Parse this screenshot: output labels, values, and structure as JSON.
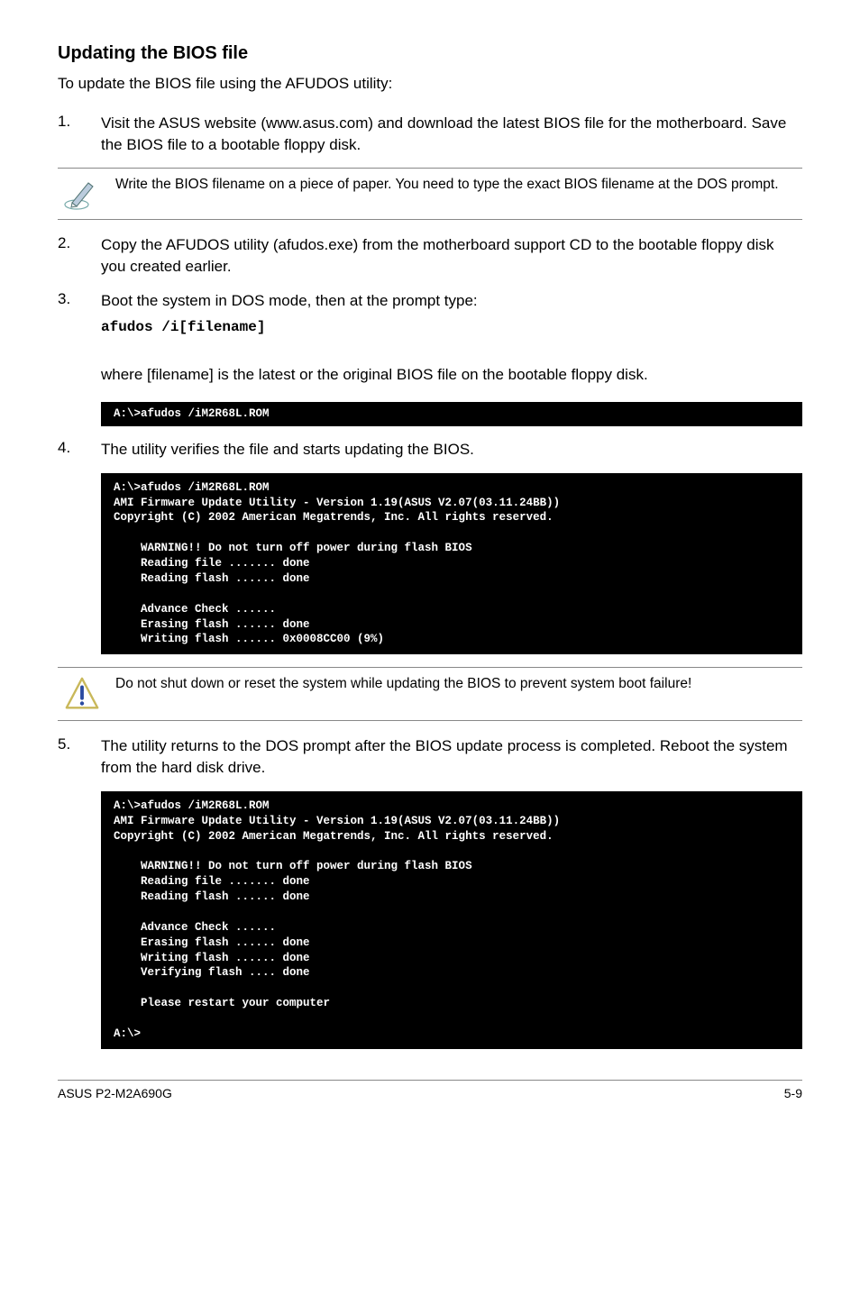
{
  "heading": "Updating the BIOS file",
  "intro": "To update the BIOS file using the AFUDOS utility:",
  "steps": {
    "s1_num": "1.",
    "s1_body": "Visit the ASUS website (www.asus.com) and download the latest BIOS file for the motherboard. Save the BIOS file to a bootable floppy disk.",
    "note1": "Write the BIOS filename on a piece of paper. You need to type the exact BIOS filename at the DOS prompt.",
    "s2_num": "2.",
    "s2_body": "Copy the AFUDOS utility (afudos.exe) from the motherboard support CD to the bootable floppy disk you created earlier.",
    "s3_num": "3.",
    "s3_body": "Boot the system in DOS mode, then at the prompt type:",
    "cmd": "afudos /i[filename]",
    "s3_para": "where [filename] is the latest or the original BIOS file on the bootable floppy disk.",
    "term1": "A:\\>afudos /iM2R68L.ROM",
    "s4_num": "4.",
    "s4_body": "The utility verifies the file and starts updating the BIOS.",
    "term2": "A:\\>afudos /iM2R68L.ROM\nAMI Firmware Update Utility - Version 1.19(ASUS V2.07(03.11.24BB))\nCopyright (C) 2002 American Megatrends, Inc. All rights reserved.\n\n    WARNING!! Do not turn off power during flash BIOS\n    Reading file ....... done\n    Reading flash ...... done\n\n    Advance Check ......\n    Erasing flash ...... done\n    Writing flash ...... 0x0008CC00 (9%)",
    "warn_note": "Do not shut down or reset the system while updating the BIOS to prevent system boot failure!",
    "s5_num": "5.",
    "s5_body": "The utility returns to the DOS prompt after the BIOS update process is completed. Reboot the system from the hard disk drive.",
    "term3": "A:\\>afudos /iM2R68L.ROM\nAMI Firmware Update Utility - Version 1.19(ASUS V2.07(03.11.24BB))\nCopyright (C) 2002 American Megatrends, Inc. All rights reserved.\n\n    WARNING!! Do not turn off power during flash BIOS\n    Reading file ....... done\n    Reading flash ...... done\n\n    Advance Check ......\n    Erasing flash ...... done\n    Writing flash ...... done\n    Verifying flash .... done\n\n    Please restart your computer\n\nA:\\>"
  },
  "footer": {
    "left": "ASUS P2-M2A690G",
    "right": "5-9"
  }
}
